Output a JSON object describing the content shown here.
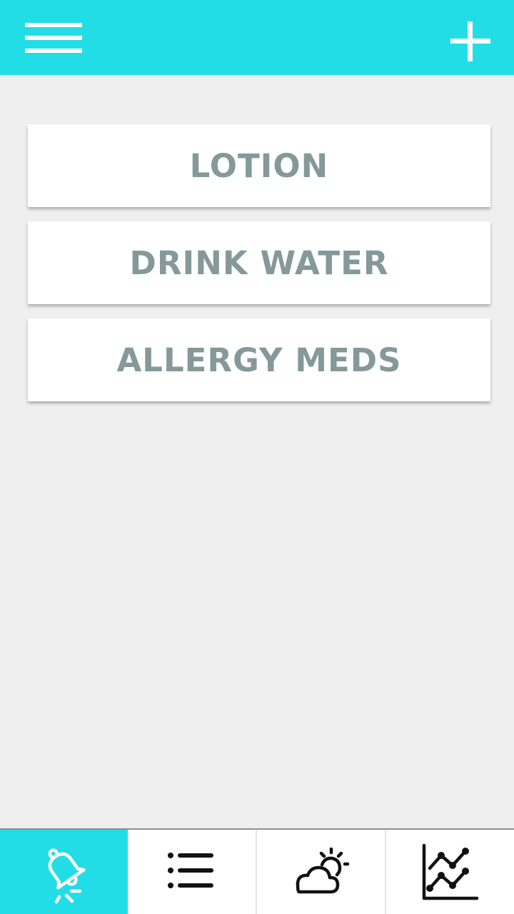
{
  "colors": {
    "accent": "#22dde6",
    "background": "#efefef",
    "card": "#ffffff",
    "card_text": "#85989a",
    "icon_dark": "#111111"
  },
  "header": {
    "left_icon": "hamburger-menu-icon",
    "right_icon": "plus-icon"
  },
  "reminders": [
    {
      "label": "LOTION"
    },
    {
      "label": "DRINK WATER"
    },
    {
      "label": "ALLERGY MEDS"
    }
  ],
  "bottom_nav": {
    "tabs": [
      {
        "icon": "bell-icon",
        "active": true
      },
      {
        "icon": "list-icon",
        "active": false
      },
      {
        "icon": "weather-icon",
        "active": false
      },
      {
        "icon": "chart-icon",
        "active": false
      }
    ]
  }
}
